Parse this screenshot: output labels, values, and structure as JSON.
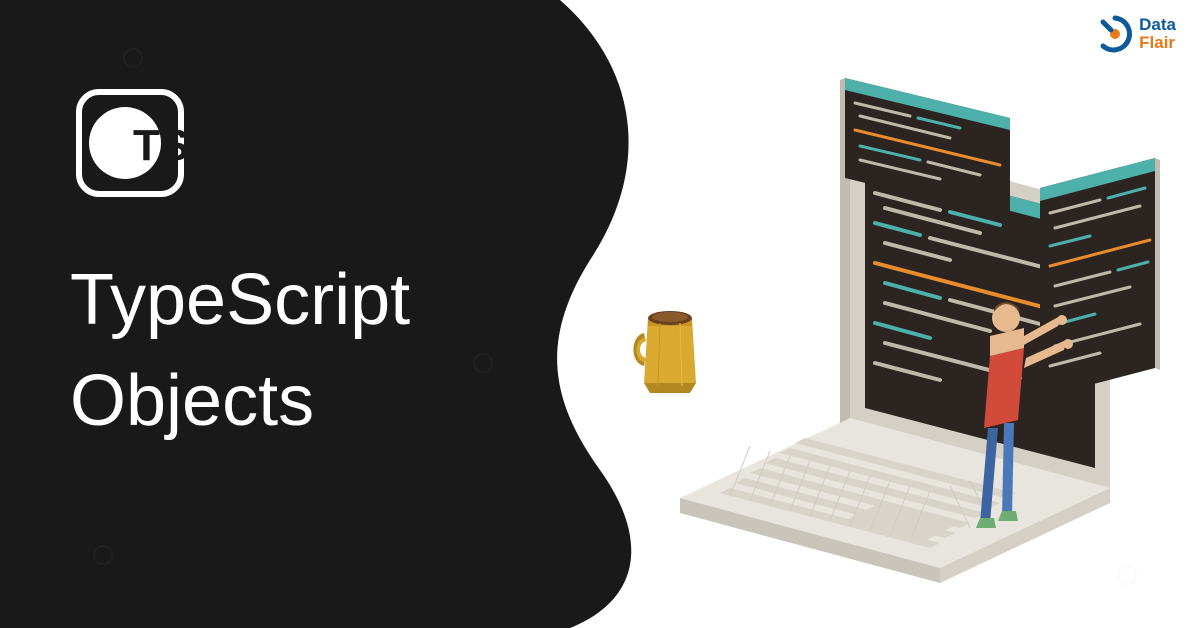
{
  "icon": {
    "label": "TS"
  },
  "heading": {
    "line1": "TypeScript",
    "line2": "Objects"
  },
  "brand": {
    "line1": "Data",
    "line2": "Flair"
  },
  "colors": {
    "dark": "#1a1919",
    "white": "#ffffff",
    "teal": "#4db0aa",
    "orange": "#e88c2e",
    "blue_brand": "#0d5a9a",
    "orange_brand": "#e67a1a",
    "mug": "#d9a930",
    "mug_dark": "#b38820",
    "laptop_light": "#e8e5de",
    "laptop_dark": "#c9c5bb",
    "code_bg": "#2b2420"
  }
}
